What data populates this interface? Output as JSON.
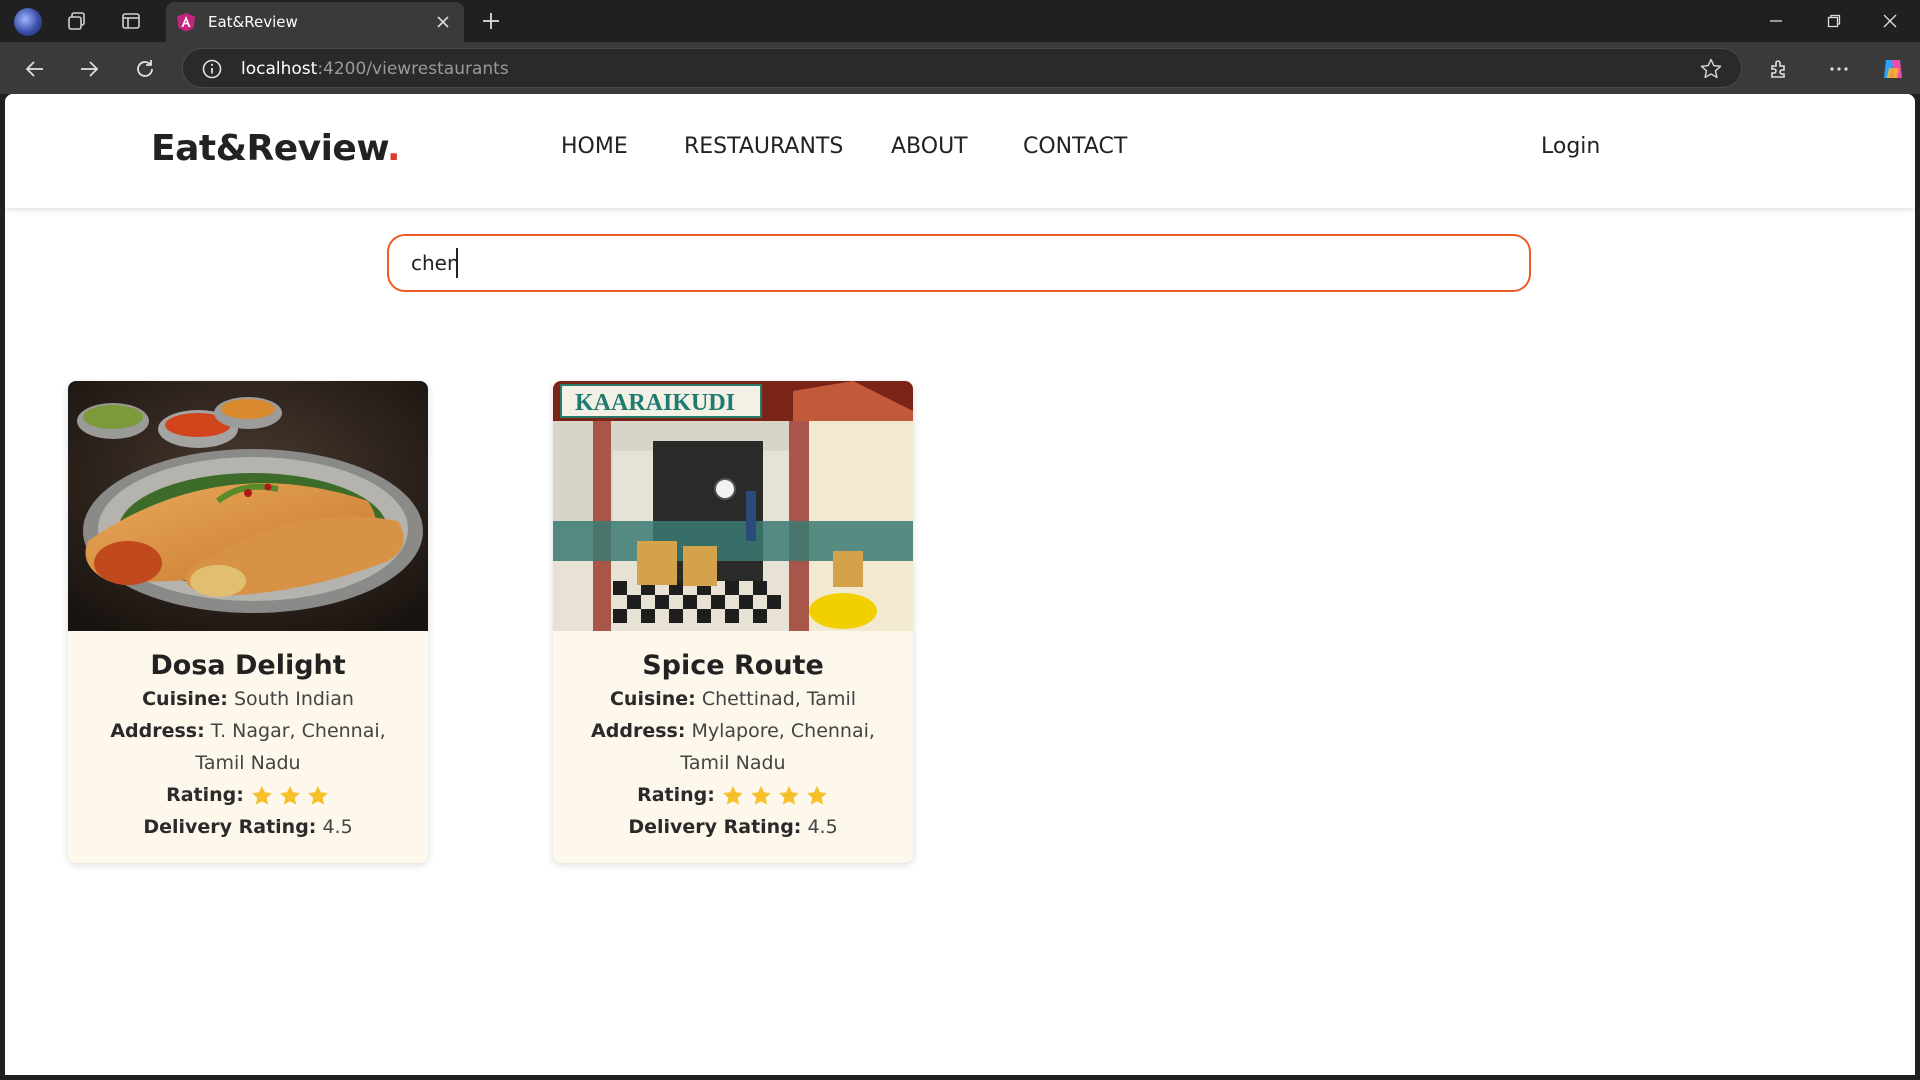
{
  "browser": {
    "tab_title": "Eat&Review",
    "url_host": "localhost",
    "url_path": ":4200/viewrestaurants"
  },
  "site": {
    "logo_text": "Eat&Review",
    "logo_dot": ".",
    "nav": [
      "HOME",
      "RESTAURANTS",
      "ABOUT",
      "CONTACT"
    ],
    "login": "Login"
  },
  "search": {
    "value": "chen"
  },
  "labels": {
    "cuisine": "Cuisine:",
    "address": "Address:",
    "rating": "Rating:",
    "delivery": "Delivery Rating:"
  },
  "restaurants": [
    {
      "name": "Dosa Delight",
      "cuisine": "South Indian",
      "address": "T. Nagar, Chennai, Tamil Nadu",
      "rating_stars": 3,
      "delivery_rating": "4.5",
      "image": "masala-dosa-plate-photo"
    },
    {
      "name": "Spice Route",
      "cuisine": "Chettinad, Tamil",
      "address": "Mylapore, Chennai, Tamil Nadu",
      "rating_stars": 4,
      "delivery_rating": "4.5",
      "image": "restaurant-storefront-photo",
      "sign_text": "KAARAIKUDI"
    }
  ],
  "colors": {
    "accent": "#ef5b24",
    "logo_dot": "#e03a2c",
    "card_bg": "#fdf7ec",
    "star": "#f5c02a"
  }
}
